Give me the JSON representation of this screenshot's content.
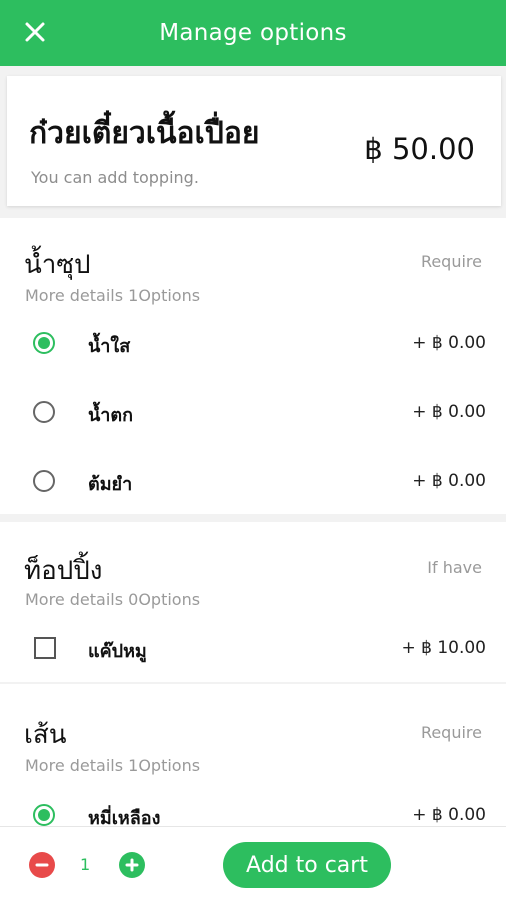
{
  "header": {
    "title": "Manage options",
    "close_icon": "close-icon"
  },
  "product": {
    "name": "ก๋วยเตี๋ยวเนื้อเปื่อย",
    "subtitle": "You can add topping.",
    "price": "฿ 50.00"
  },
  "sections": [
    {
      "title": "น้ำซุป",
      "tag": "Require",
      "details": "More details 1Options",
      "type": "radio",
      "options": [
        {
          "label": "น้ำใส",
          "price": "+ ฿ 0.00",
          "selected": true
        },
        {
          "label": "น้ำตก",
          "price": "+ ฿ 0.00",
          "selected": false
        },
        {
          "label": "ต้มยำ",
          "price": "+ ฿ 0.00",
          "selected": false
        }
      ]
    },
    {
      "title": "ท็อปปิ้ง",
      "tag": "If have",
      "details": "More details 0Options",
      "type": "checkbox",
      "options": [
        {
          "label": "แค๊ปหมู",
          "price": "+ ฿ 10.00",
          "selected": false
        }
      ]
    },
    {
      "title": "เส้น",
      "tag": "Require",
      "details": "More details 1Options",
      "type": "radio",
      "options": [
        {
          "label": "หมี่เหลือง",
          "price": "+ ฿ 0.00",
          "selected": true
        }
      ]
    }
  ],
  "footer": {
    "quantity": "1",
    "minus_icon": "minus-icon",
    "plus_icon": "plus-icon",
    "add_label": "Add to cart"
  },
  "colors": {
    "accent": "#2dbe5f",
    "minus": "#e84a4a"
  }
}
